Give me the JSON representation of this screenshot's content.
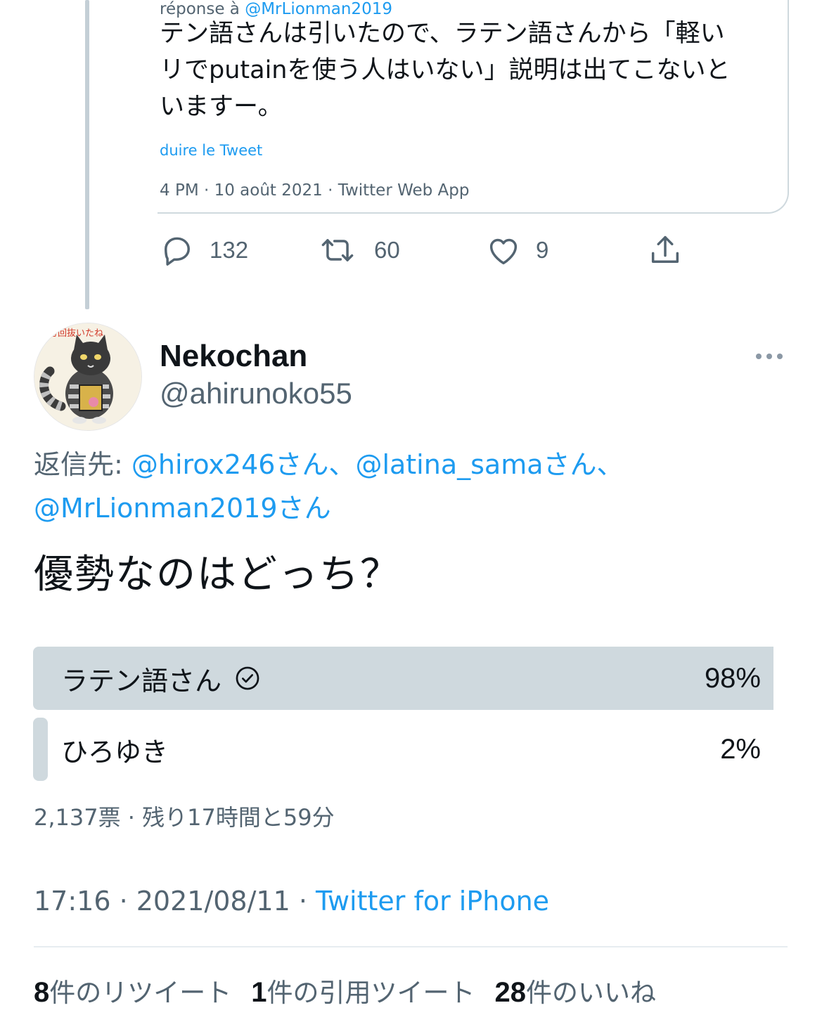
{
  "quoted_tweet": {
    "reply_prefix": "réponse à ",
    "reply_mention": "@MrLionman2019",
    "text": "テン語さんは引いたので、ラテン語さんから「軽い\nリでputainを使う人はいない」説明は出てこないと\nいますー。",
    "translate_link": "duire le Tweet",
    "meta": "4 PM · 10 août 2021 · Twitter Web App"
  },
  "actions": {
    "reply_count": "132",
    "retweet_count": "60",
    "like_count": "9",
    "icons": [
      "reply-icon",
      "retweet-icon",
      "like-icon",
      "share-icon"
    ]
  },
  "author": {
    "name": "Nekochan",
    "handle": "@ahirunoko55",
    "avatar_caption": "万回抜いたね"
  },
  "reply_to": {
    "prefix": "返信先: ",
    "m1": "@hirox246さん",
    "sep1": "、",
    "m2": "@latina_samaさん",
    "sep2": "、",
    "m3": "@MrLionman2019さん"
  },
  "tweet_text": "優勢なのはどっち？",
  "poll": {
    "options": [
      {
        "label": "ラテン語さん",
        "percent_text": "98%",
        "percent": 98,
        "winner": true
      },
      {
        "label": "ひろゆき",
        "percent_text": "2%",
        "percent": 2,
        "winner": false
      }
    ],
    "meta": "2,137票 · 残り17時間と59分"
  },
  "timestamp": {
    "time": "17:16 · 2021/08/11 · ",
    "source": "Twitter for iPhone"
  },
  "stats": {
    "retweets_num": "8",
    "retweets_label": "件のリツイート",
    "quotes_num": "1",
    "quotes_label": "件の引用ツイート",
    "likes_num": "28",
    "likes_label": "件のいいね"
  },
  "colors": {
    "accent": "#1d9bf0",
    "secondary_text": "#536471",
    "poll_fill": "#cfd9de"
  }
}
